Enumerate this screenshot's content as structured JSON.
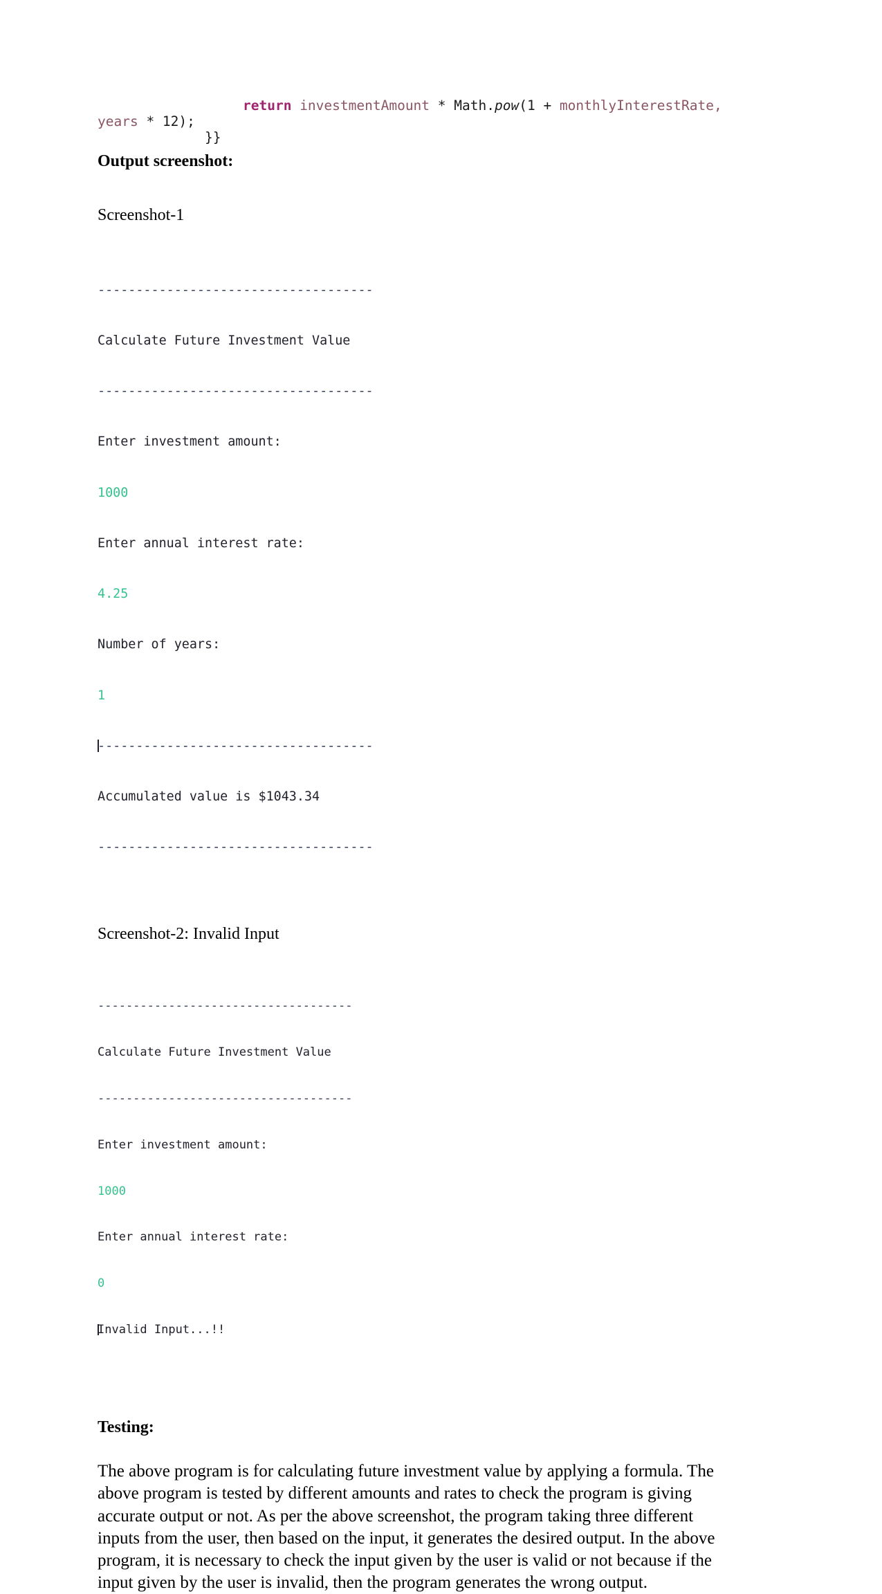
{
  "document": {
    "code_snippet": {
      "line1_keyword": "return",
      "line1_rest_a": " investmentAmount",
      "line1_op1": " * ",
      "line1_math": "Math.",
      "line1_pow": "pow",
      "line1_open": "(1 + ",
      "line1_rate": "monthlyInterestRate,",
      "line2_a": "years",
      "line2_b": " * 12);",
      "line3": "}}"
    },
    "output_heading": "Output screenshot:",
    "screenshot1": {
      "caption": "Screenshot-1",
      "lines": [
        {
          "type": "rule",
          "text": "------------------------------------"
        },
        {
          "type": "out",
          "text": "Calculate Future Investment Value"
        },
        {
          "type": "rule",
          "text": "------------------------------------"
        },
        {
          "type": "out",
          "text": "Enter investment amount:"
        },
        {
          "type": "in",
          "text": "1000"
        },
        {
          "type": "out",
          "text": "Enter annual interest rate:"
        },
        {
          "type": "in",
          "text": "4.25"
        },
        {
          "type": "out",
          "text": "Number of years:"
        },
        {
          "type": "in",
          "text": "1"
        },
        {
          "type": "rule-cursor",
          "text": "------------------------------------"
        },
        {
          "type": "out",
          "text": "Accumulated value is $1043.34"
        },
        {
          "type": "rule",
          "text": "------------------------------------"
        }
      ]
    },
    "screenshot2": {
      "caption": "Screenshot-2: Invalid Input",
      "lines": [
        {
          "type": "rule",
          "text": "------------------------------------"
        },
        {
          "type": "out",
          "text": "Calculate Future Investment Value"
        },
        {
          "type": "rule",
          "text": "------------------------------------"
        },
        {
          "type": "out",
          "text": "Enter investment amount:"
        },
        {
          "type": "in",
          "text": "1000"
        },
        {
          "type": "out",
          "text": "Enter annual interest rate:"
        },
        {
          "type": "in",
          "text": "0"
        },
        {
          "type": "out-cursor",
          "text": "Invalid Input...!!"
        }
      ]
    },
    "testing_heading": "Testing:",
    "testing_paragraph": "The above program is for calculating future investment value by applying a formula. The above program is tested by different amounts and rates to check the program is giving accurate output or not. As per the above screenshot, the program taking three different inputs from the user, then based on the input, it generates the desired output. In the above program, it is necessary to check the input given by the user is valid or not because if the input given by the user is invalid, then the program generates the wrong output."
  },
  "colors": {
    "keyword": "#a0246e",
    "identifier": "#8a5663",
    "terminal_output": "#21222c",
    "terminal_input": "#35c28f",
    "page_background": "#ffffff"
  }
}
